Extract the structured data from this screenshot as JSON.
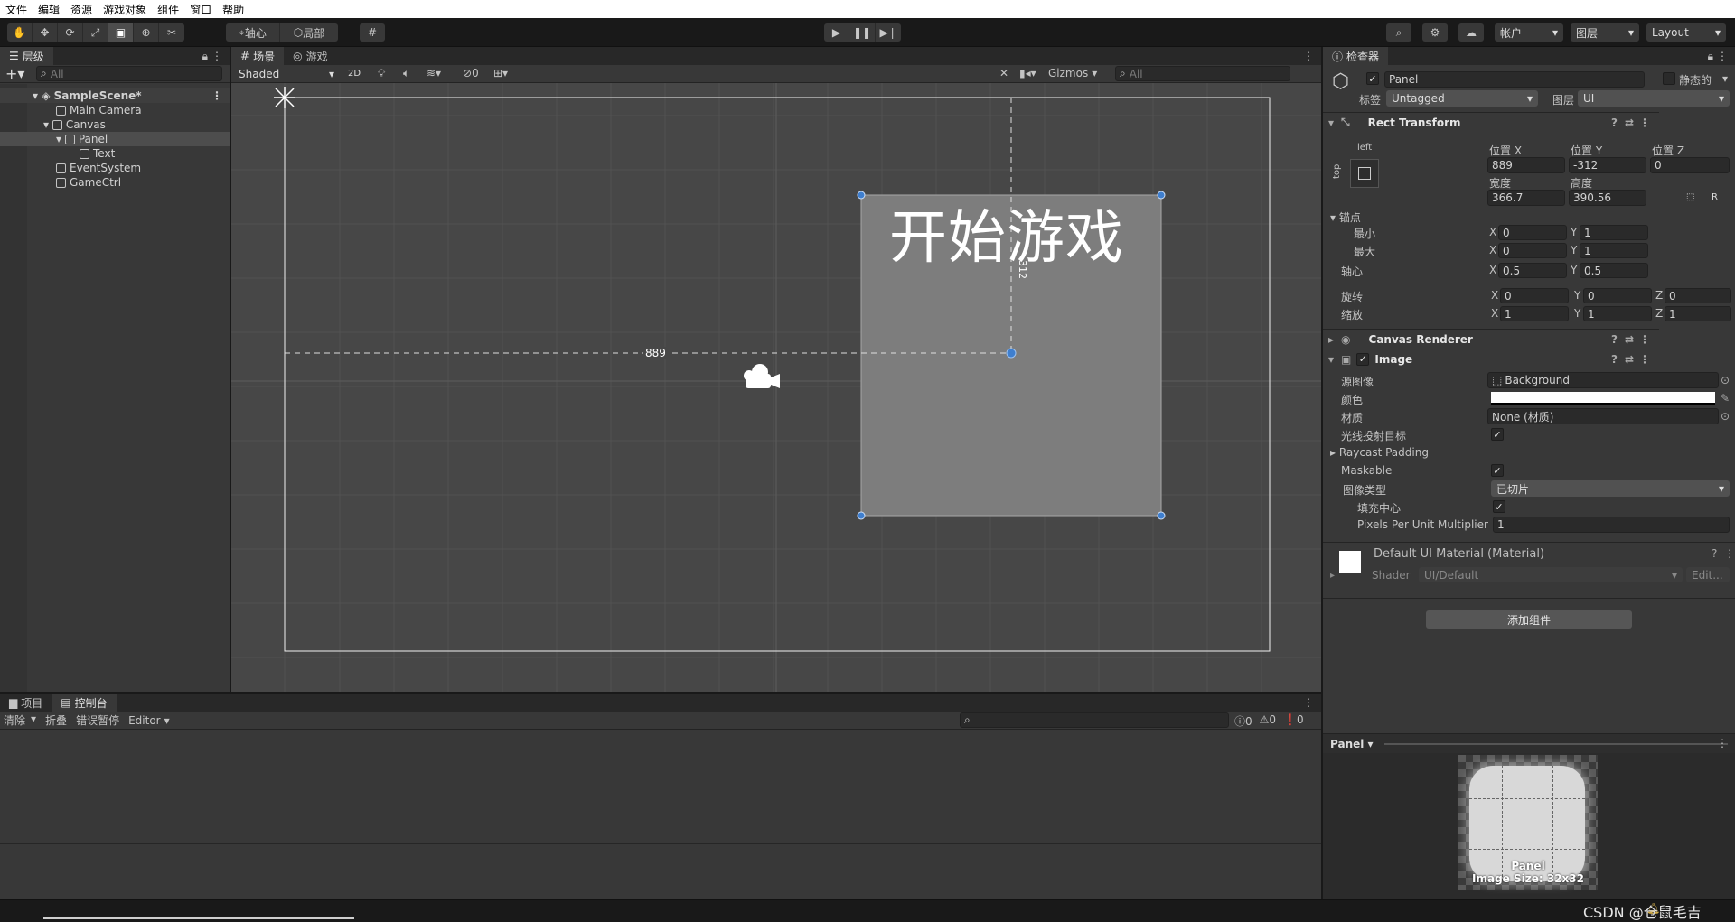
{
  "menu": [
    "文件",
    "编辑",
    "资源",
    "游戏对象",
    "组件",
    "窗口",
    "帮助"
  ],
  "toolbar": {
    "pivot": "轴心",
    "local": "局部",
    "account": "帐户",
    "layers": "图层",
    "layout": "Layout"
  },
  "hierarchy": {
    "tab": "层级",
    "search_placeholder": "All",
    "items": [
      {
        "label": "SampleScene*",
        "depth": 0
      },
      {
        "label": "Main Camera",
        "depth": 1
      },
      {
        "label": "Canvas",
        "depth": 1
      },
      {
        "label": "Panel",
        "depth": 2
      },
      {
        "label": "Text",
        "depth": 3
      },
      {
        "label": "EventSystem",
        "depth": 1
      },
      {
        "label": "GameCtrl",
        "depth": 1
      }
    ]
  },
  "scene": {
    "tab_scene": "场景",
    "tab_game": "游戏",
    "shading": "Shaded",
    "mode2d": "2D",
    "hidden_count": "0",
    "gizmos": "Gizmos",
    "search_placeholder": "All",
    "panel_text": "开始游戏",
    "measure_x": "889",
    "measure_y": "312"
  },
  "console": {
    "tab_project": "项目",
    "tab_console": "控制台",
    "clear": "清除",
    "collapse": "折叠",
    "error_pause": "错误暂停",
    "editor": "Editor",
    "count_log": "0",
    "count_warn": "0",
    "count_err": "0"
  },
  "inspector": {
    "tab": "检查器",
    "object_name": "Panel",
    "static_label": "静态的",
    "tag_label": "标签",
    "tag_value": "Untagged",
    "layer_label": "图层",
    "layer_value": "UI",
    "rect_transform": {
      "title": "Rect Transform",
      "anchor_h": "left",
      "anchor_v": "top",
      "pos_x_label": "位置 X",
      "pos_y_label": "位置 Y",
      "pos_z_label": "位置 Z",
      "pos_x": "889",
      "pos_y": "-312",
      "pos_z": "0",
      "width_label": "宽度",
      "height_label": "高度",
      "width": "366.7",
      "height": "390.56",
      "r_button": "R",
      "anchors_label": "锚点",
      "min_label": "最小",
      "max_label": "最大",
      "min_x": "0",
      "min_y": "1",
      "max_x": "0",
      "max_y": "1",
      "pivot_label": "轴心",
      "pivot_x": "0.5",
      "pivot_y": "0.5",
      "rotation_label": "旋转",
      "rot_x": "0",
      "rot_y": "0",
      "rot_z": "0",
      "scale_label": "缩放",
      "scale_x": "1",
      "scale_y": "1",
      "scale_z": "1"
    },
    "canvas_renderer": "Canvas Renderer",
    "image": {
      "title": "Image",
      "source_label": "源图像",
      "source_value": "Background",
      "color_label": "颜色",
      "material_label": "材质",
      "material_value": "None (材质)",
      "raycast_label": "光线投射目标",
      "raycast_padding": "Raycast Padding",
      "maskable": "Maskable",
      "image_type_label": "图像类型",
      "image_type_value": "已切片",
      "fill_center_label": "填充中心",
      "ppu_label": "Pixels Per Unit Multiplier",
      "ppu_value": "1"
    },
    "material": {
      "title": "Default UI Material (Material)",
      "shader_label": "Shader",
      "shader_value": "UI/Default",
      "edit": "Edit..."
    },
    "add_component": "添加组件",
    "preview": {
      "name": "Panel",
      "caption_name": "Panel",
      "caption_size": "Image Size: 32x32"
    }
  },
  "watermark": "CSDN @仓鼠毛吉",
  "colors": {
    "accent_blue": "#3f7fcf",
    "panel_grey": "#7d7d7d",
    "scene_bg": "#474747"
  }
}
